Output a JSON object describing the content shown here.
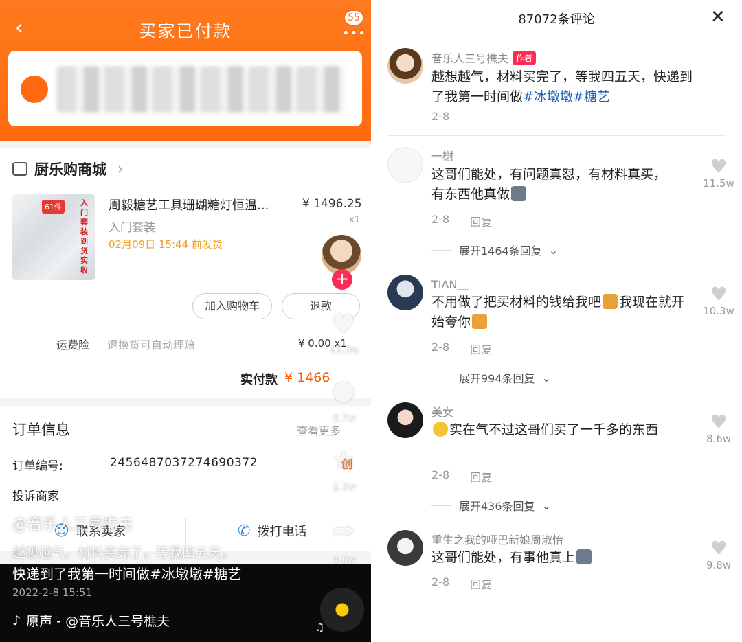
{
  "left": {
    "header": {
      "title": "买家已付款",
      "badge": "55"
    },
    "shop": {
      "name": "厨乐购商城"
    },
    "product": {
      "title": "周毅糖艺工具珊瑚糖灯恒温...",
      "price": "¥ 1496.25",
      "qty": "x1",
      "spec": "入门套装",
      "ship": "02月09日 15:44 前发货",
      "img_tag": "61件",
      "img_text": "入门套装 到货实收"
    },
    "buttons": {
      "add_cart": "加入购物车",
      "refund": "退款"
    },
    "freight": {
      "label": "运费险",
      "desc": "退换货可自动理赔",
      "price": "¥ 0.00 x1"
    },
    "paid": {
      "label": "实付款",
      "amount": "¥ 1466"
    },
    "order": {
      "title": "订单信息",
      "more": "查看更多",
      "number_label": "订单编号:",
      "number": "2456487037274690372",
      "complaint": "投诉商家"
    },
    "actions": {
      "contact": "联系卖家",
      "call": "拨打电话"
    },
    "overlay": {
      "stats": [
        "11.5w",
        "9.7w",
        "5.3w",
        "4.0w"
      ],
      "badge_text": "创",
      "user": "@音乐人三号樵夫",
      "caption_line1": "越想越气，材料买完了，等我四五天，",
      "caption_line2": "快递到了我第一时间做#冰墩墩#糖艺",
      "time": "2022-2-8 15:51",
      "music": "原声 - @音乐人三号樵夫"
    }
  },
  "right": {
    "title": "87072条评论",
    "comments": [
      {
        "name": "音乐人三号樵夫",
        "author_tag": "作者",
        "text": "越想越气，材料买完了，等我四五天，快递到了我第一时间做",
        "tags": "#冰墩墩#糖艺",
        "date": "2-8"
      },
      {
        "name": "一榭",
        "text": "这哥们能处，有问题真怼，有材料真买，有东西他真做",
        "date": "2-8",
        "reply": "回复",
        "likes": "11.5w",
        "expand": "展开1464条回复"
      },
      {
        "name": "TIAN＿",
        "text_a": "不用做了把买材料的钱给我吧",
        "text_b": "我现在就开始夸你",
        "date": "2-8",
        "reply": "回复",
        "likes": "10.3w",
        "expand": "展开994条回复"
      },
      {
        "name": "美女",
        "text": "实在气不过这哥们买了一千多的东西",
        "date": "2-8",
        "reply": "回复",
        "likes": "8.6w",
        "expand": "展开436条回复"
      },
      {
        "name": "重生之我的哑巴新娘周淑怡",
        "text": "这哥们能处，有事他真上",
        "date": "2-8",
        "reply": "回复",
        "likes": "9.8w"
      }
    ]
  }
}
